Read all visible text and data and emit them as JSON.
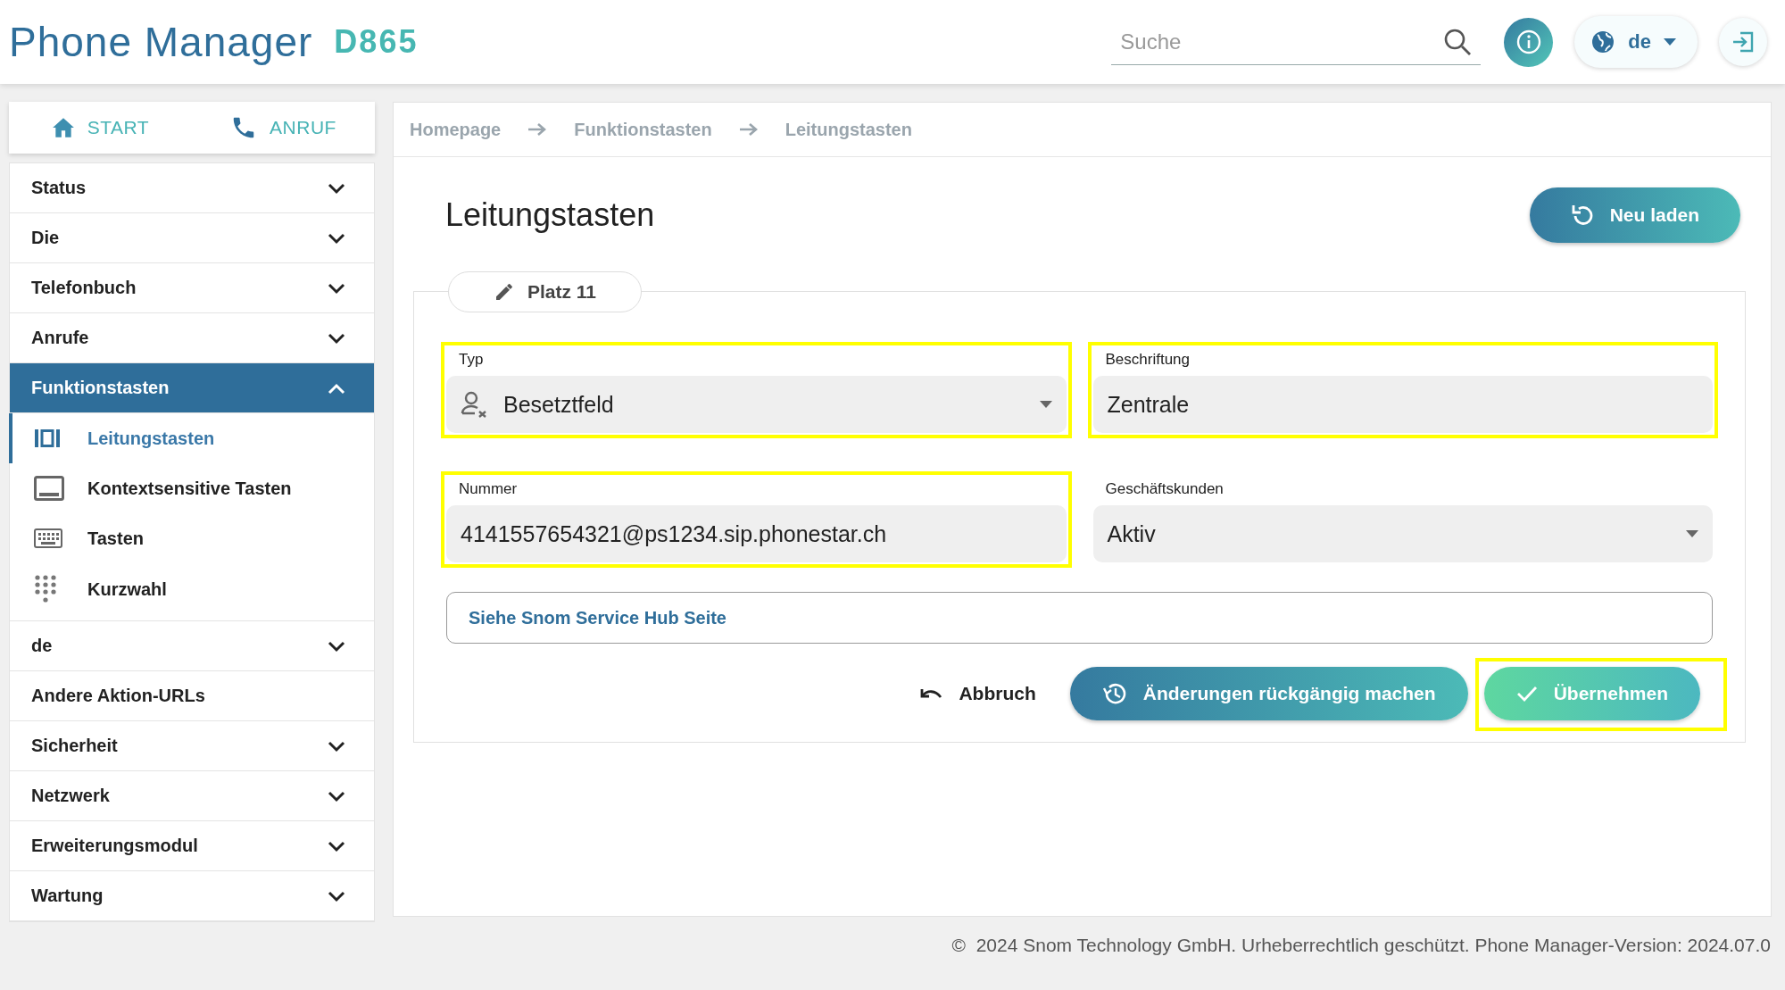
{
  "header": {
    "logo": "Phone Manager",
    "model": "D865",
    "search": {
      "placeholder": "Suche"
    },
    "language": "de"
  },
  "sidebar": {
    "shortcuts": [
      {
        "label": "START"
      },
      {
        "label": "ANRUF"
      }
    ],
    "items": [
      {
        "label": "Status",
        "expanded": false,
        "selected": false
      },
      {
        "label": "Die",
        "expanded": false,
        "selected": false
      },
      {
        "label": "Telefonbuch",
        "expanded": false,
        "selected": false
      },
      {
        "label": "Anrufe",
        "expanded": false,
        "selected": false
      },
      {
        "label": "Funktionstasten",
        "expanded": true,
        "selected": true,
        "children": [
          {
            "label": "Leitungstasten",
            "selected": true
          },
          {
            "label": "Kontextsensitive Tasten",
            "selected": false
          },
          {
            "label": "Tasten",
            "selected": false
          },
          {
            "label": "Kurzwahl",
            "selected": false
          }
        ]
      },
      {
        "label": "de",
        "expanded": false,
        "selected": false
      },
      {
        "label": "Andere Aktion-URLs",
        "selected": false
      },
      {
        "label": "Sicherheit",
        "expanded": false,
        "selected": false
      },
      {
        "label": "Netzwerk",
        "expanded": false,
        "selected": false
      },
      {
        "label": "Erweiterungsmodul",
        "expanded": false,
        "selected": false
      },
      {
        "label": "Wartung",
        "expanded": false,
        "selected": false
      }
    ]
  },
  "breadcrumb": [
    "Homepage",
    "Funktionstasten",
    "Leitungstasten"
  ],
  "page": {
    "title": "Leitungstasten",
    "reload_button": "Neu laden",
    "tab": "Platz 11",
    "fields": [
      {
        "kind": "select",
        "label": "Typ",
        "value": "Besetztfeld",
        "highlighted": true
      },
      {
        "kind": "text",
        "label": "Beschriftung",
        "value": "Zentrale",
        "highlighted": true
      },
      {
        "kind": "text",
        "label": "Nummer",
        "value": "4141557654321@ps1234.sip.phonestar.ch",
        "highlighted": true
      },
      {
        "kind": "select",
        "label": "Geschäftskunden",
        "value": "Aktiv",
        "highlighted": false
      }
    ],
    "link": "Siehe Snom Service Hub Seite",
    "actions": [
      {
        "kind": "plain",
        "label": "Abbruch",
        "highlighted": false
      },
      {
        "kind": "revert",
        "label": "Änderungen rückgängig machen",
        "highlighted": false
      },
      {
        "kind": "apply",
        "label": "Übernehmen",
        "highlighted": true
      }
    ]
  },
  "footer": "©  2024 Snom Technology GmbH. Urheberrechtlich geschützt. Phone Manager-Version: 2024.07.0"
}
